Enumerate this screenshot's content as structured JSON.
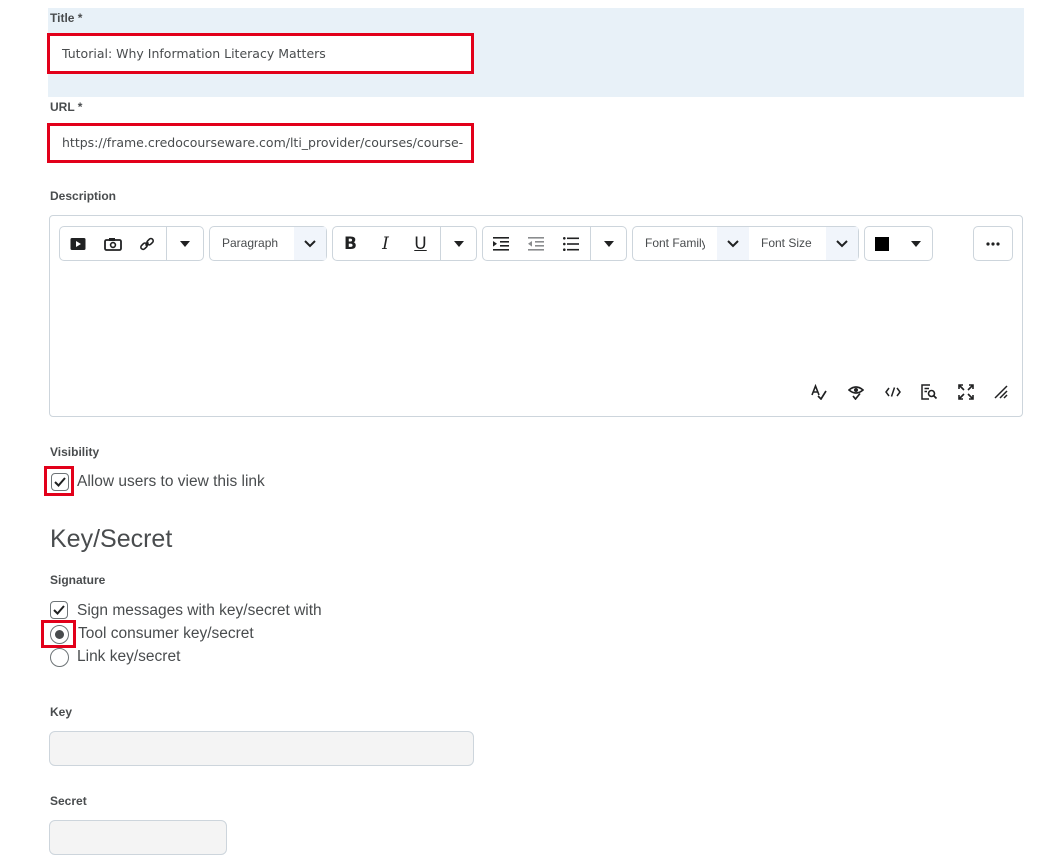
{
  "title_field": {
    "label": "Title *",
    "value": "Tutorial: Why Information Literacy Matters"
  },
  "url_field": {
    "label": "URL *",
    "value": "https://frame.credocourseware.com/lti_provider/courses/course-"
  },
  "description": {
    "label": "Description",
    "toolbar": {
      "block_format": "Paragraph",
      "font_family": "Font Family",
      "font_size": "Font Size",
      "text_color": "#000000"
    },
    "icons": {
      "insert": [
        "video-icon",
        "insert-image-icon",
        "link-icon",
        "chevron-down-icon"
      ],
      "format": [
        "bold-icon",
        "italic-icon",
        "underline-icon",
        "chevron-down-icon"
      ],
      "lists": [
        "indent-icon",
        "outdent-icon",
        "bullet-list-icon",
        "chevron-down-icon"
      ],
      "status_bar": [
        "spellcheck-icon",
        "accessibility-checker-icon",
        "source-code-icon",
        "preview-icon",
        "fullscreen-icon",
        "resize-handle-icon"
      ]
    }
  },
  "visibility": {
    "label": "Visibility",
    "checkbox_label": "Allow users to view this link",
    "checked": true
  },
  "key_secret": {
    "heading": "Key/Secret",
    "signature_label": "Signature",
    "sign_messages_label": "Sign messages with key/secret with",
    "sign_messages_checked": true,
    "options": [
      {
        "label": "Tool consumer key/secret",
        "selected": true
      },
      {
        "label": "Link key/secret",
        "selected": false
      }
    ],
    "key_label": "Key",
    "key_value": "",
    "secret_label": "Secret",
    "secret_value": ""
  },
  "colors": {
    "highlight": "#e2001a",
    "title_band": "#e8f1f8",
    "text": "#494c4e"
  }
}
